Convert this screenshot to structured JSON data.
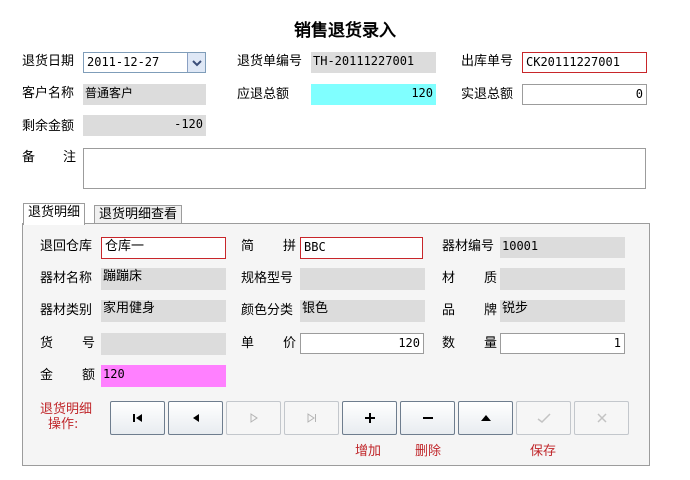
{
  "title": "销售退货录入",
  "header": {
    "return_date_label": "退货日期",
    "return_date_value": "2011-12-27",
    "return_no_label": "退货单编号",
    "return_no_value": "TH-20111227001",
    "outbound_no_label": "出库单号",
    "outbound_no_value": "CK20111227001",
    "customer_label": "客户名称",
    "customer_value": "普通客户",
    "refund_total_label": "应退总额",
    "refund_total_value": "120",
    "actual_refund_label": "实退总额",
    "actual_refund_value": "0",
    "remaining_label": "剩余金额",
    "remaining_value": "-120",
    "remark_label_1": "备",
    "remark_label_2": "注",
    "remark_value": ""
  },
  "tabs": [
    {
      "label": "退货明细",
      "active": true
    },
    {
      "label": "退货明细查看",
      "active": false
    }
  ],
  "detail": {
    "warehouse_label": "退回仓库",
    "warehouse_value": "仓库一",
    "shortcode_label_1": "简",
    "shortcode_label_2": "拼",
    "shortcode_value": "BBC",
    "equip_no_label": "器材编号",
    "equip_no_value": "10001",
    "equip_name_label": "器材名称",
    "equip_name_value": "蹦蹦床",
    "spec_label": "规格型号",
    "spec_value": "",
    "material_label_1": "材",
    "material_label_2": "质",
    "material_value": "",
    "category_label": "器材类别",
    "category_value": "家用健身",
    "color_label": "颜色分类",
    "color_value": "银色",
    "brand_label_1": "品",
    "brand_label_2": "牌",
    "brand_value": "锐步",
    "item_no_label_1": "货",
    "item_no_label_2": "号",
    "item_no_value": "",
    "price_label_1": "单",
    "price_label_2": "价",
    "price_value": "120",
    "qty_label_1": "数",
    "qty_label_2": "量",
    "qty_value": "1",
    "amount_label_1": "金",
    "amount_label_2": "额",
    "amount_value": "120"
  },
  "ops": {
    "label_line1": "退货明细",
    "label_line2": "操作:",
    "add_label": "增加",
    "delete_label": "删除",
    "save_label": "保存"
  },
  "colors": {
    "refund_total_bg": "#80ffff",
    "amount_bg": "#ff80ff",
    "required_border": "#c8262a"
  }
}
